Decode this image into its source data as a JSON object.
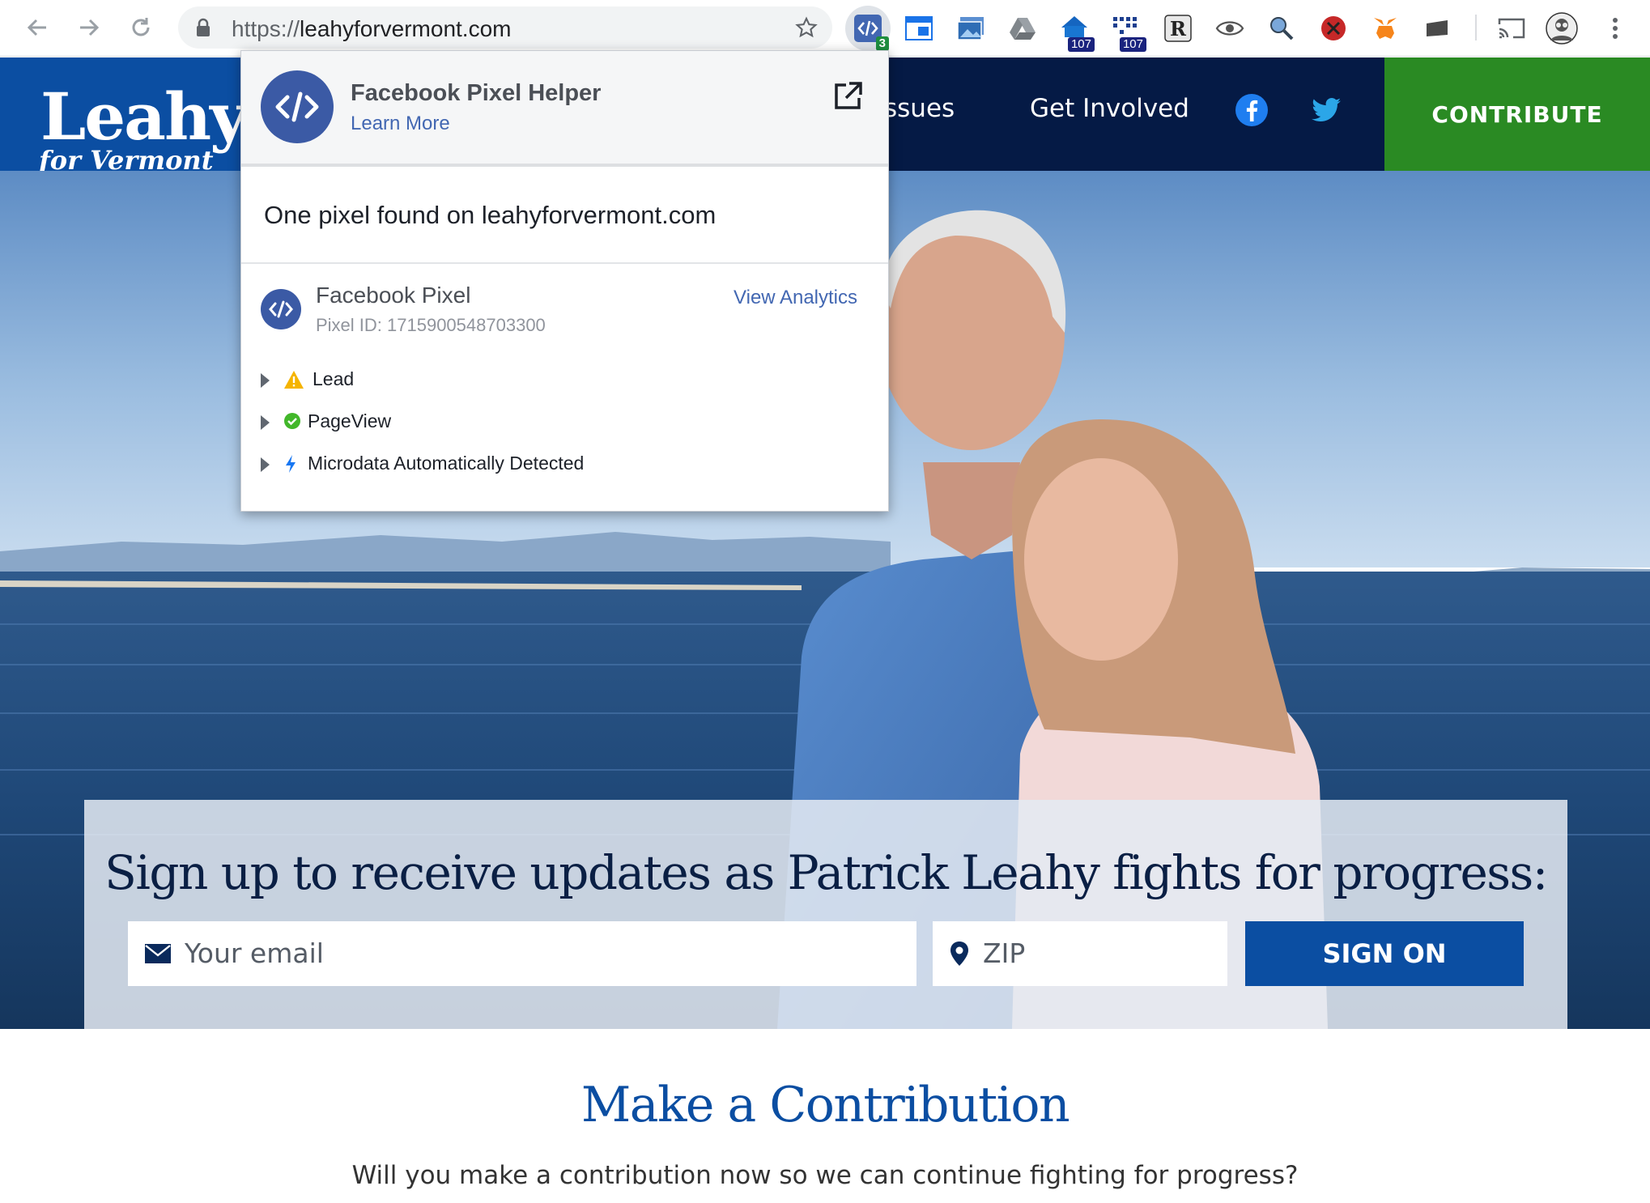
{
  "browser": {
    "url_scheme": "https://",
    "url_host": "leahyforvermont.com",
    "extensions": [
      {
        "name": "facebook-pixel-helper",
        "badge": "3",
        "active": true
      },
      {
        "name": "window-extension"
      },
      {
        "name": "image-extension"
      },
      {
        "name": "google-drive"
      },
      {
        "name": "extension-badge-1",
        "badge": "107"
      },
      {
        "name": "extension-badge-2",
        "badge": "107"
      },
      {
        "name": "r-extension",
        "glyph": "R"
      },
      {
        "name": "eye-extension"
      },
      {
        "name": "magnifier-extension"
      },
      {
        "name": "blocker-extension"
      },
      {
        "name": "metamask-extension"
      },
      {
        "name": "keyboard-extension"
      },
      {
        "name": "cast"
      }
    ]
  },
  "site": {
    "logo": {
      "main": "Leahy",
      "sub": "for Vermont"
    },
    "nav": {
      "issues_partial": "ssues",
      "get_involved": "Get Involved"
    },
    "contribute_label": "CONTRIBUTE",
    "colors": {
      "navy": "#051a45",
      "blue": "#0b4ea2",
      "green": "#2a8a23"
    }
  },
  "signup": {
    "title": "Sign up to receive updates as Patrick Leahy fights for progress:",
    "email_placeholder": "Your email",
    "zip_placeholder": "ZIP",
    "button": "SIGN ON"
  },
  "contribution": {
    "title": "Make a Contribution",
    "text": "Will you make a contribution now so we can continue fighting for progress?"
  },
  "pixel_helper": {
    "title": "Facebook Pixel Helper",
    "learn_more": "Learn More",
    "summary": "One pixel found on leahyforvermont.com",
    "pixel_name": "Facebook Pixel",
    "pixel_id": "Pixel ID: 1715900548703300",
    "view_analytics": "View Analytics",
    "events": [
      {
        "label": "Lead",
        "status": "warning"
      },
      {
        "label": "PageView",
        "status": "success"
      },
      {
        "label": "Microdata Automatically Detected",
        "status": "info"
      }
    ]
  }
}
